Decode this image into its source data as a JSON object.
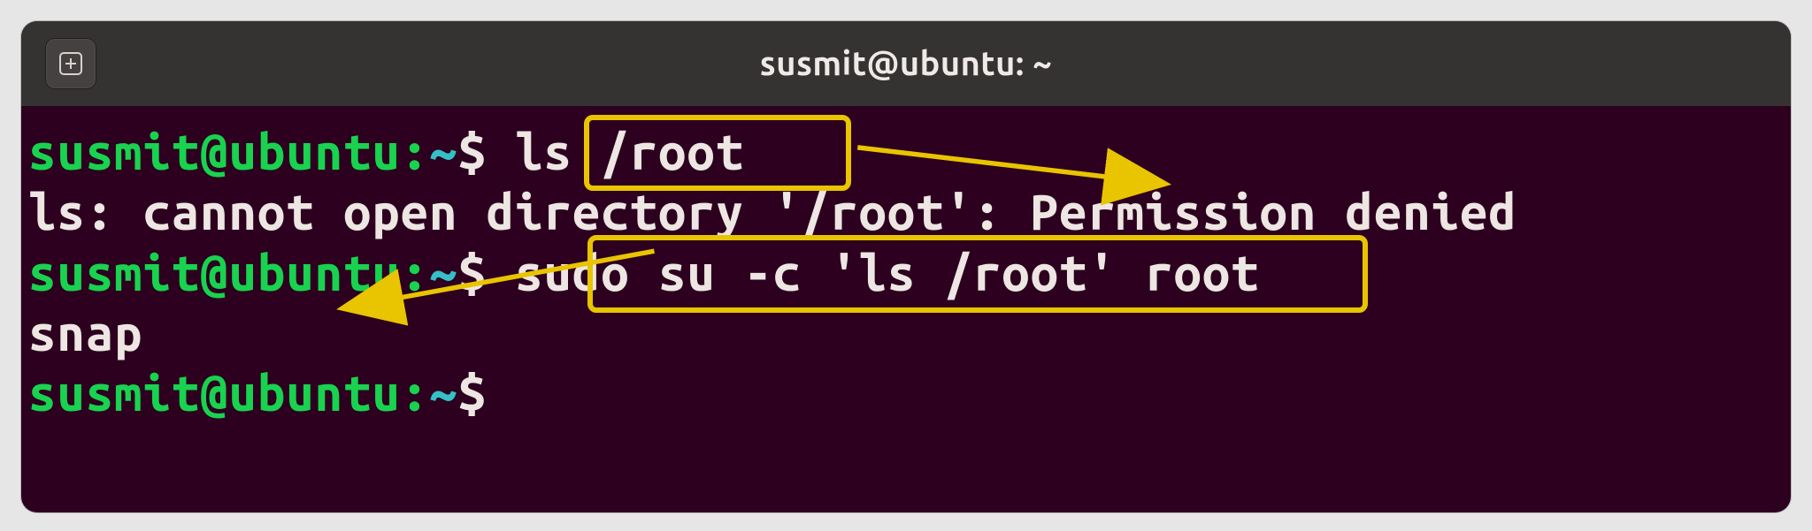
{
  "colors": {
    "bg": "#2c001e",
    "titlebar": "#353232",
    "prompt_user": "#19d24f",
    "prompt_path": "#34c0c6",
    "text": "#ede6e3",
    "highlight": "#e9c400"
  },
  "window": {
    "title": "susmit@ubuntu: ~"
  },
  "prompt": {
    "user_host": "susmit@ubuntu",
    "colon": ":",
    "path": "~",
    "dollar": "$ "
  },
  "lines": {
    "cmd1": "ls /root",
    "out1": "ls: cannot open directory '/root': Permission denied",
    "cmd2": "sudo su -c 'ls /root' root",
    "out2": "snap"
  },
  "icons": {
    "new_tab": "⊞"
  }
}
